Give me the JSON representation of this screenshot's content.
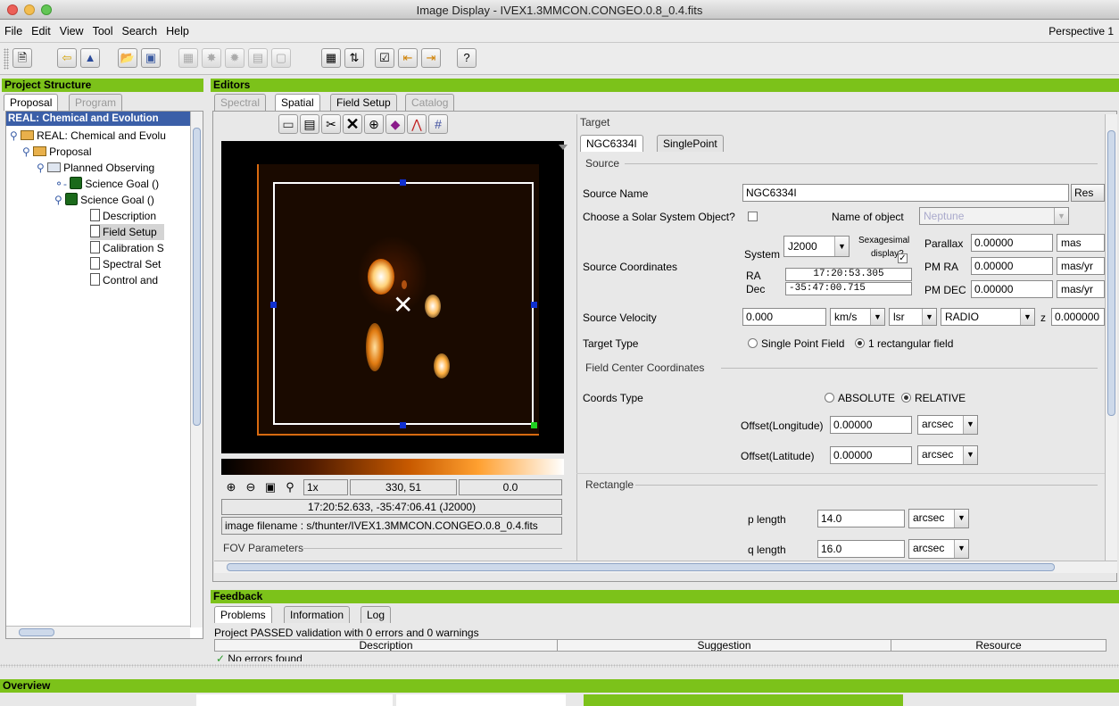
{
  "window": {
    "title": "Image Display - IVEX1.3MMCON.CONGEO.0.8_0.4.fits",
    "perspective": "Perspective 1"
  },
  "menu": [
    "File",
    "Edit",
    "View",
    "Tool",
    "Search",
    "Help"
  ],
  "toolbar_icons": [
    "new-icon",
    "back-icon",
    "forward-icon",
    "open-icon",
    "save-icon",
    "disabled1-icon",
    "disabled2-icon",
    "disabled3-icon",
    "disabled4-icon",
    "disabled5-icon",
    "calculator-icon",
    "sort-icon",
    "validate-icon",
    "import-icon",
    "export-icon",
    "help-icon"
  ],
  "project": {
    "header": "Project Structure",
    "tabs": [
      "Proposal",
      "Program"
    ],
    "title_bar": "REAL: Chemical and Evolution",
    "tree": [
      {
        "label": "REAL: Chemical and Evolu",
        "icon": "folder"
      },
      {
        "label": "Proposal",
        "icon": "folder"
      },
      {
        "label": "Planned Observing",
        "icon": "folder"
      },
      {
        "label": "Science Goal ()",
        "icon": "goal"
      },
      {
        "label": "Science Goal ()",
        "icon": "goal"
      },
      {
        "label": "Description",
        "icon": "file"
      },
      {
        "label": "Field Setup",
        "icon": "file"
      },
      {
        "label": "Calibration S",
        "icon": "file"
      },
      {
        "label": "Spectral Set",
        "icon": "file"
      },
      {
        "label": "Control and",
        "icon": "file"
      }
    ]
  },
  "editors": {
    "header": "Editors",
    "tabs": [
      "Spectral",
      "Spatial",
      "Field Setup",
      "Catalog"
    ]
  },
  "image": {
    "toolbar_icons": [
      "open-icon",
      "save-icon",
      "cut-icon",
      "delete-icon",
      "circle-plus-icon",
      "diamond-icon",
      "plot-icon",
      "grid-icon"
    ],
    "zoom": "1x",
    "pixel": "330, 51",
    "value": "0.0",
    "coords": "17:20:52.633, -35:47:06.41 (J2000)",
    "filename": "image filename : s/thunter/IVEX1.3MMCON.CONGEO.0.8_0.4.fits",
    "fov_label": "FOV Parameters"
  },
  "target": {
    "section": "Target",
    "tabs": [
      "NGC6334I",
      "SinglePoint"
    ],
    "source_section": "Source",
    "source_name_label": "Source Name",
    "source_name": "NGC6334I",
    "resolve_button": "Res",
    "solar_label": "Choose a Solar System Object?",
    "name_object_label": "Name of object",
    "name_object_value": "Neptune",
    "coords_label": "Source Coordinates",
    "system_label": "System",
    "system_value": "J2000",
    "sexagesimal_label1": "Sexagesimal",
    "sexagesimal_label2": "display?",
    "ra_label": "RA",
    "ra_value": "17:20:53.305",
    "dec_label": "Dec",
    "dec_value": "-35:47:00.715",
    "parallax_label": "Parallax",
    "parallax_value": "0.00000",
    "parallax_unit": "mas",
    "pmra_label": "PM RA",
    "pmra_value": "0.00000",
    "pmra_unit": "mas/yr",
    "pmdec_label": "PM DEC",
    "pmdec_value": "0.00000",
    "pmdec_unit": "mas/yr",
    "velocity_label": "Source Velocity",
    "velocity_value": "0.000",
    "velocity_unit": "km/s",
    "velocity_frame": "lsr",
    "velocity_def": "RADIO",
    "z_label": "z",
    "z_value": "0.000000",
    "target_type_label": "Target Type",
    "target_type_opt1": "Single Point Field",
    "target_type_opt2": "1 rectangular field"
  },
  "field_center": {
    "section": "Field Center Coordinates",
    "coords_type_label": "Coords Type",
    "opt_absolute": "ABSOLUTE",
    "opt_relative": "RELATIVE",
    "offset_long_label": "Offset(Longitude)",
    "offset_long_value": "0.00000",
    "offset_lat_label": "Offset(Latitude)",
    "offset_lat_value": "0.00000",
    "unit": "arcsec"
  },
  "rectangle": {
    "section": "Rectangle",
    "p_label": "p length",
    "p_value": "14.0",
    "q_label": "q length",
    "q_value": "16.0",
    "unit": "arcsec"
  },
  "feedback": {
    "header": "Feedback",
    "tabs": [
      "Problems",
      "Information",
      "Log"
    ],
    "status": "Project PASSED validation with 0 errors and 0 warnings",
    "columns": [
      "Description",
      "Suggestion",
      "Resource"
    ],
    "row": "No errors found"
  },
  "overview": {
    "header": "Overview"
  },
  "colors": {
    "accent_green": "#7cc21a",
    "header_blue": "#3b5fa8",
    "colorbar_end": "#ffffff"
  }
}
